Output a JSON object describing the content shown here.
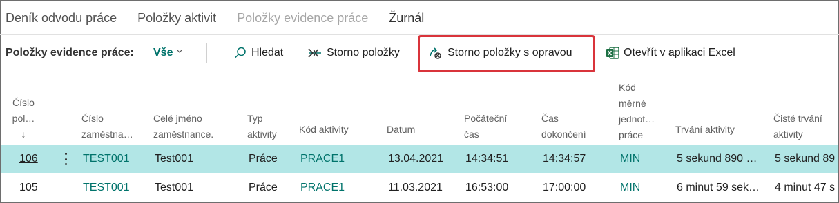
{
  "topnav": {
    "items": [
      {
        "label": "Deník odvodu práce"
      },
      {
        "label": "Položky aktivit"
      },
      {
        "label": "Položky evidence práce"
      },
      {
        "label": "Žurnál"
      }
    ]
  },
  "actionbar": {
    "title": "Položky evidence práce:",
    "filter": "Vše",
    "search_label": "Hledat",
    "reverse_label": "Storno položky",
    "reverse_correct_label": "Storno položky s opravou",
    "excel_label": "Otevřít v aplikaci Excel",
    "highlight_color": "#d9343b"
  },
  "table": {
    "headers": {
      "entry_no": [
        "Číslo",
        "pol…",
        "↓"
      ],
      "employee_no": [
        "Číslo",
        "zaměstna…"
      ],
      "employee_name": [
        "Celé jméno",
        "zaměstnance."
      ],
      "activity_type": [
        "Typ",
        "aktivity"
      ],
      "activity_code": [
        "Kód aktivity"
      ],
      "date": [
        "Datum"
      ],
      "start_time": [
        "Počáteční",
        "čas"
      ],
      "end_time": [
        "Čas",
        "dokončení"
      ],
      "uom_code": [
        "Kód",
        "měrné",
        "jednot…",
        "práce"
      ],
      "duration": [
        "Trvání aktivity"
      ],
      "net_duration": [
        "Čisté trvání",
        "aktivity"
      ]
    },
    "rows": [
      {
        "entry_no": "106",
        "employee_no": "TEST001",
        "employee_name": "Test001",
        "activity_type": "Práce",
        "activity_code": "PRACE1",
        "date": "13.04.2021",
        "start_time": "14:34:51",
        "end_time": "14:34:57",
        "uom_code": "MIN",
        "duration": "5 sekund 890 …",
        "net_duration": "5 sekund 89",
        "selected": true
      },
      {
        "entry_no": "105",
        "employee_no": "TEST001",
        "employee_name": "Test001",
        "activity_type": "Práce",
        "activity_code": "PRACE1",
        "date": "11.03.2021",
        "start_time": "16:53:00",
        "end_time": "17:00:00",
        "uom_code": "MIN",
        "duration": "6 minut 59 sek…",
        "net_duration": "4 minut 47 s",
        "selected": false
      }
    ]
  },
  "colors": {
    "accent": "#00736b",
    "selected_row": "#b2e6e6"
  }
}
